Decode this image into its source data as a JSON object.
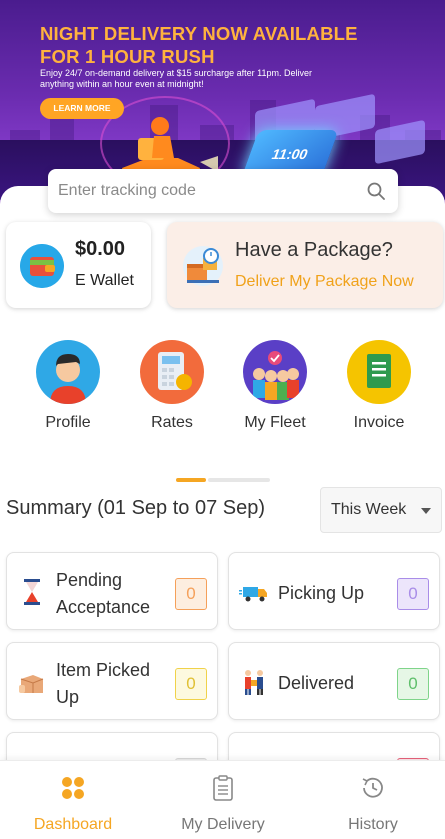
{
  "banner": {
    "title": "NIGHT DELIVERY NOW AVAILABLE FOR 1 HOUR RUSH",
    "subtitle": "Enjoy 24/7 on-demand delivery at $15 surcharge after 11pm. Deliver anything within an hour even at midnight!",
    "cta": "LEARN MORE",
    "phone_time": "11:00"
  },
  "search": {
    "placeholder": "Enter tracking code"
  },
  "wallet": {
    "amount": "$0.00",
    "label": "E Wallet"
  },
  "package": {
    "title": "Have a Package?",
    "action": "Deliver My Package Now"
  },
  "shortcuts": [
    {
      "label": "Profile",
      "icon": "profile-icon"
    },
    {
      "label": "Rates",
      "icon": "calculator-icon"
    },
    {
      "label": "My Fleet",
      "icon": "fleet-icon"
    },
    {
      "label": "Invoice",
      "icon": "invoice-icon"
    }
  ],
  "summary": {
    "title": "Summary (01 Sep to 07 Sep)",
    "period": "This Week"
  },
  "statuses": [
    {
      "label_line1": "Pending",
      "label_line2": "Acceptance",
      "count": "0",
      "color": "#f5a05a",
      "bg": "#fdeee0",
      "icon": "hourglass-icon"
    },
    {
      "label_line1": "Picking Up",
      "label_line2": "",
      "count": "0",
      "color": "#a98de8",
      "bg": "#ece5fb",
      "icon": "truck-icon"
    },
    {
      "label_line1": "Item Picked",
      "label_line2": "Up",
      "count": "0",
      "color": "#f0d24a",
      "bg": "#fdf9df",
      "icon": "box-icon"
    },
    {
      "label_line1": "Delivered",
      "label_line2": "",
      "count": "0",
      "color": "#7fd48a",
      "bg": "#e6f7e6",
      "icon": "delivered-icon"
    }
  ],
  "nav": [
    {
      "label": "Dashboard",
      "active": true
    },
    {
      "label": "My Delivery",
      "active": false
    },
    {
      "label": "History",
      "active": false
    }
  ],
  "colors": {
    "accent": "#f5a623",
    "inactive": "#777777"
  }
}
